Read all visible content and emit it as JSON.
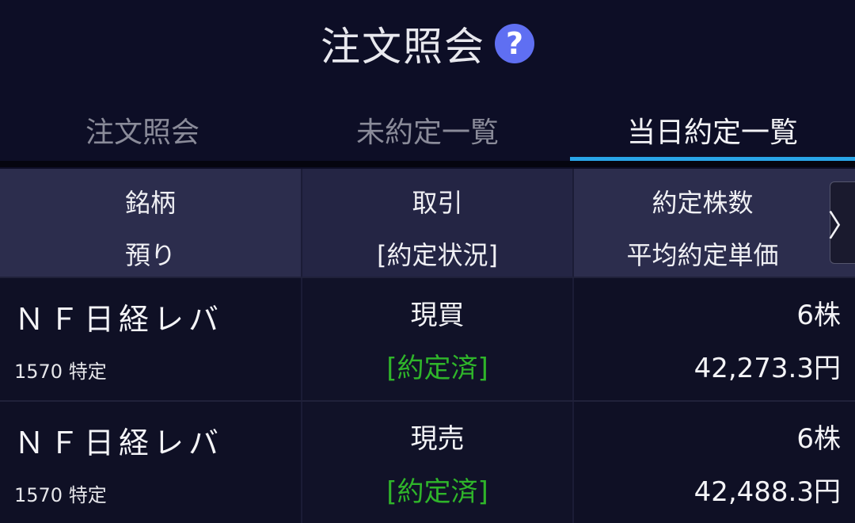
{
  "header": {
    "title": "注文照会",
    "help_icon": "?"
  },
  "tabs": [
    {
      "label": "注文照会",
      "active": false
    },
    {
      "label": "未約定一覧",
      "active": false
    },
    {
      "label": "当日約定一覧",
      "active": true
    }
  ],
  "columns": {
    "col1": {
      "line1": "銘柄",
      "line2": "預り"
    },
    "col2": {
      "line1": "取引",
      "line2": "[約定状況]"
    },
    "col3": {
      "line1": "約定株数",
      "line2": "平均約定単価"
    },
    "scroll_icon": "〉"
  },
  "rows": [
    {
      "name": "ＮＦ日経レバ",
      "code_account": "1570 特定",
      "trade": "現買",
      "status": "[約定済]",
      "quantity": "6株",
      "avg_price": "42,273.3円"
    },
    {
      "name": "ＮＦ日経レバ",
      "code_account": "1570 特定",
      "trade": "現売",
      "status": "[約定済]",
      "quantity": "6株",
      "avg_price": "42,488.3円"
    }
  ],
  "colors": {
    "background": "#0d0e26",
    "accent": "#29a5e8",
    "status_green": "#2fb52a",
    "help_icon": "#5f6ff2"
  }
}
